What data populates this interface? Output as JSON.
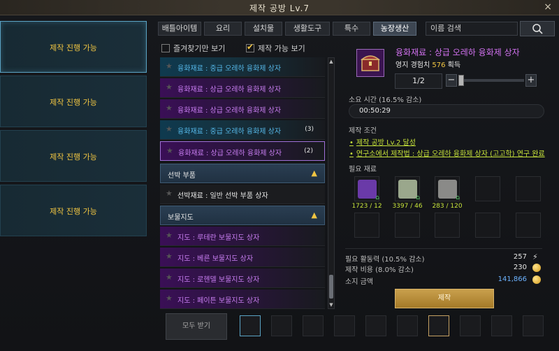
{
  "window": {
    "title": "제작 공방 Lv.7",
    "close_icon": "×"
  },
  "left_slots": [
    {
      "label": "제작 진행 가능"
    },
    {
      "label": "제작 진행 가능"
    },
    {
      "label": "제작 진행 가능"
    },
    {
      "label": "제작 진행 가능"
    }
  ],
  "tabs": [
    "배틀아이템",
    "요리",
    "설치물",
    "생활도구",
    "특수",
    "농장생산"
  ],
  "selected_tab": "농장생산",
  "search": {
    "value": "이름 검색",
    "icon": "search-icon"
  },
  "filters": {
    "favorites_label": "즐겨찾기만 보기",
    "favorites_checked": false,
    "craftable_label": "제작 가능 보기",
    "craftable_checked": true
  },
  "list": {
    "items": [
      {
        "name": "융화재료 : 중급 오레하 융화제 상자",
        "color": "blue",
        "count": ""
      },
      {
        "name": "융화재료 : 상급 오레하 융화제 상자",
        "color": "purple",
        "count": ""
      },
      {
        "name": "융화재료 : 상급 오레하 융화제 상자",
        "color": "purple",
        "count": ""
      },
      {
        "name": "융화재료 : 중급 오레하 융화제 상자",
        "color": "blue",
        "count": "(3)"
      },
      {
        "name": "융화재료 : 상급 오레하 융화제 상자",
        "color": "purple",
        "count": "(2)"
      }
    ],
    "category_ship": "선박 부품",
    "ship_item": "선박재료 : 일반 선박 부품 상자",
    "category_map": "보물지도",
    "map_items": [
      "지도 : 루테란 보물지도 상자",
      "지도 : 베른 보물지도 상자",
      "지도 : 로헨델 보물지도 상자",
      "지도 : 페이튼 보물지도 상자"
    ]
  },
  "bottom": {
    "get_all_label": "모두 받기"
  },
  "detail": {
    "item_name": "융화재료 : 상급 오레하 융화제 상자",
    "exp_label": "영지 경험치",
    "exp_value": "576",
    "exp_suffix": "획득",
    "quantity": "1/2",
    "quantity_fraction": 0.0,
    "time_label": "소요 시간 (16.5% 감소)",
    "time_value": "00:50:29",
    "conditions_label": "제작 조건",
    "conditions": [
      "제작 공방 Lv.2 달성",
      "연구소에서 제작법 : 상급 오레하 융화제 상자 (고고학) 연구 완료"
    ],
    "materials_label": "필요 재료",
    "materials": [
      {
        "qty": "1723 / 12",
        "icon": "oreha-material-icon",
        "color": "#6a3aa8"
      },
      {
        "qty": "3397 / 46",
        "icon": "relic-stone-icon",
        "color": "#9aa78c"
      },
      {
        "qty": "283 / 120",
        "icon": "ancient-relic-icon",
        "color": "#8a8a88"
      }
    ],
    "energy_label": "필요 활동력 (10.5% 감소)",
    "energy_value": "257",
    "cost_label": "제작 비용 (8.0% 감소)",
    "cost_value": "230",
    "gold_label": "소지 금액",
    "gold_value": "141,866",
    "craft_button": "제작"
  }
}
